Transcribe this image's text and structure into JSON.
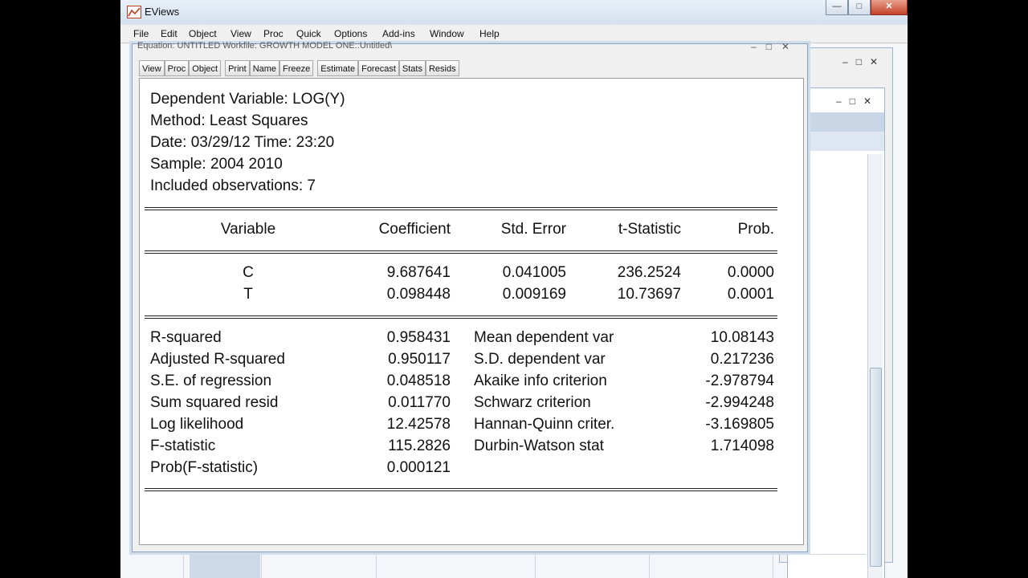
{
  "app": {
    "title": "EViews",
    "colors": {
      "titlebar": "#dbe6f3",
      "close": "#c2412a"
    }
  },
  "menu": [
    "File",
    "Edit",
    "Object",
    "View",
    "Proc",
    "Quick",
    "Options",
    "Add-ins",
    "Window",
    "Help"
  ],
  "window_controls": {
    "minimize": "—",
    "maximize": "□",
    "close": "✕"
  },
  "equation_window": {
    "title": "Equation: UNTITLED   Workfile: GROWTH MODEL ONE::Untitled\\",
    "toolbar": [
      "View",
      "Proc",
      "Object",
      "Print",
      "Name",
      "Freeze",
      "Estimate",
      "Forecast",
      "Stats",
      "Resids"
    ],
    "header": [
      "Dependent Variable: LOG(Y)",
      "Method: Least Squares",
      "Date: 03/29/12   Time: 23:20",
      "Sample: 2004 2010",
      "Included observations: 7"
    ],
    "columns": [
      "Variable",
      "Coefficient",
      "Std. Error",
      "t-Statistic",
      "Prob."
    ],
    "rows": [
      {
        "variable": "C",
        "coefficient": "9.687641",
        "std_error": "0.041005",
        "t_stat": "236.2524",
        "prob": "0.0000"
      },
      {
        "variable": "T",
        "coefficient": "0.098448",
        "std_error": "0.009169",
        "t_stat": "10.73697",
        "prob": "0.0001"
      }
    ],
    "stats_left": [
      {
        "label": "R-squared",
        "value": "0.958431"
      },
      {
        "label": "Adjusted R-squared",
        "value": "0.950117"
      },
      {
        "label": "S.E. of regression",
        "value": "0.048518"
      },
      {
        "label": "Sum squared resid",
        "value": "0.011770"
      },
      {
        "label": "Log likelihood",
        "value": "12.42578"
      },
      {
        "label": "F-statistic",
        "value": "115.2826"
      },
      {
        "label": "Prob(F-statistic)",
        "value": "0.000121"
      }
    ],
    "stats_right": [
      {
        "label": "Mean dependent var",
        "value": "10.08143"
      },
      {
        "label": "S.D. dependent var",
        "value": "0.217236"
      },
      {
        "label": "Akaike info criterion",
        "value": "-2.978794"
      },
      {
        "label": "Schwarz criterion",
        "value": "-2.994248"
      },
      {
        "label": "Hannan-Quinn criter.",
        "value": "-3.169805"
      },
      {
        "label": "Durbin-Watson stat",
        "value": "1.714098"
      }
    ]
  }
}
